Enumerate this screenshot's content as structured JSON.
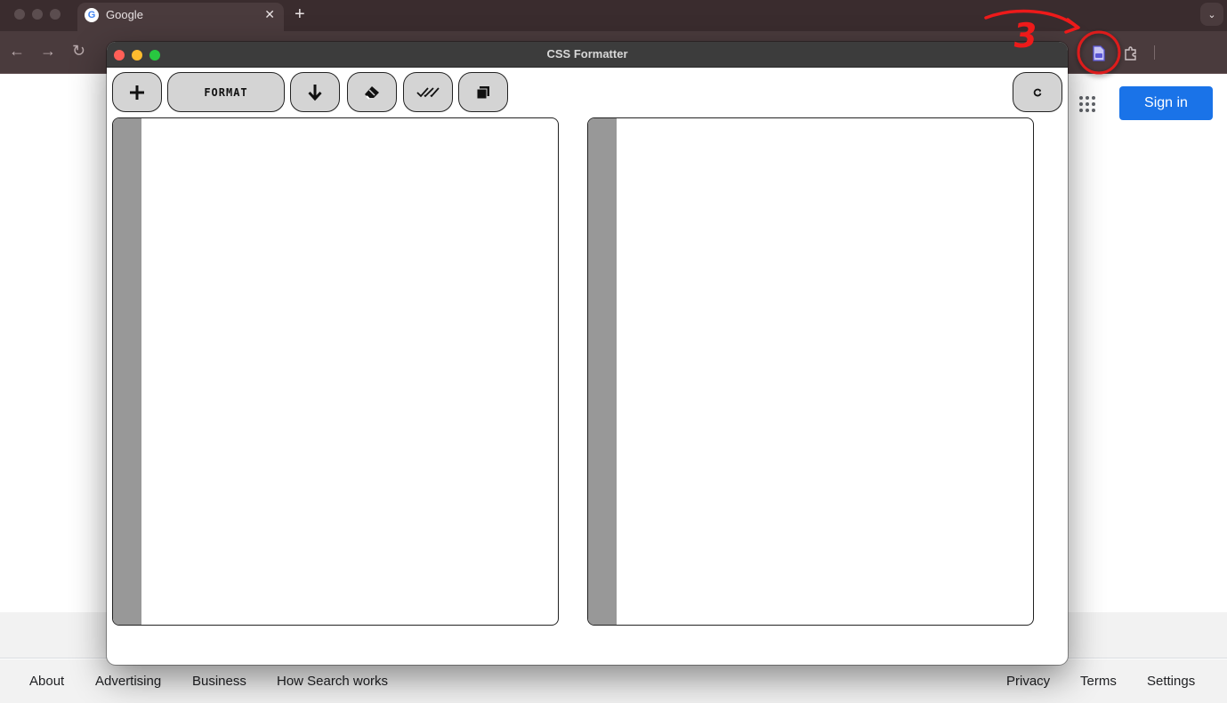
{
  "browser": {
    "tab": {
      "title": "Google",
      "favicon_letter": "G"
    },
    "icons": {
      "close": "close-icon",
      "new_tab": "plus-icon",
      "tab_search": "chevron-down-icon",
      "back": "arrow-left-icon",
      "forward": "arrow-right-icon",
      "reload": "reload-icon",
      "css_extension": "css-file-icon",
      "extensions": "puzzle-icon"
    },
    "close_glyph": "✕",
    "newtab_glyph": "+",
    "tab_search_glyph": "⌄",
    "back_glyph": "←",
    "forward_glyph": "→",
    "reload_glyph": "↻"
  },
  "google": {
    "sign_in_label": "Sign in",
    "footer_left": [
      "About",
      "Advertising",
      "Business",
      "How Search works"
    ],
    "footer_right": [
      "Privacy",
      "Terms",
      "Settings"
    ],
    "sign_in_color": "#1a73e8"
  },
  "popup": {
    "title": "CSS Formatter",
    "toolbar": {
      "format_label": "FORMAT",
      "buttons": [
        "plus-icon",
        "format-button",
        "download-icon",
        "eraser-icon",
        "double-check-icon",
        "copy-icon",
        "refresh-icon"
      ]
    },
    "input_editor": {
      "content": ""
    },
    "output_editor": {
      "content": ""
    },
    "colors": {
      "gutter": "#989898",
      "button_bg": "#d4d4d4"
    }
  },
  "annotation": {
    "step_number": "3",
    "color": "#ee1a1a"
  }
}
